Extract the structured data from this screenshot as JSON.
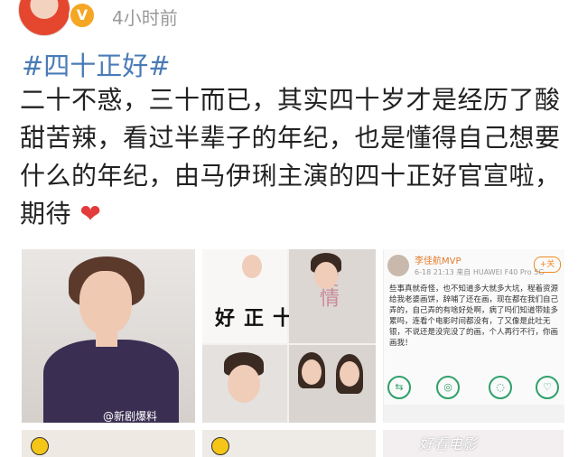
{
  "header": {
    "verified_badge": "V",
    "time": "4小时前"
  },
  "post": {
    "topic": "#四十正好#",
    "text": "二十不惑，三十而已，其实四十岁才是经历了酸甜苦辣，看过半辈子的年纪，也是懂得自己想要什么的年纪，由马伊琍主演的四十正好官宣啦，期待",
    "heart_icon": "heart-icon"
  },
  "images": {
    "tile1_watermark": "@新剧爆料",
    "tile2_title": "四十正好",
    "tile2_poster_text": "爱情",
    "comment": {
      "name": "李佳航MVP",
      "meta": "6-18 21:13 来自 HUAWEI F40 Pro 5G",
      "follow": "+关",
      "text": "些事真就奇怪，也不知道多大就多大坑，程着资源给我老婆画饼，辞哺了还在画，现在都在我们自己弄的，自己弄的有啥好处啊，病了吗们知道带娃多累吗，连看个电影时间都没有，了又像是此吐无银，不说还是没完没了的画，个人再行不行，你画画我！"
    },
    "tile6_watermark": "好看电影"
  }
}
